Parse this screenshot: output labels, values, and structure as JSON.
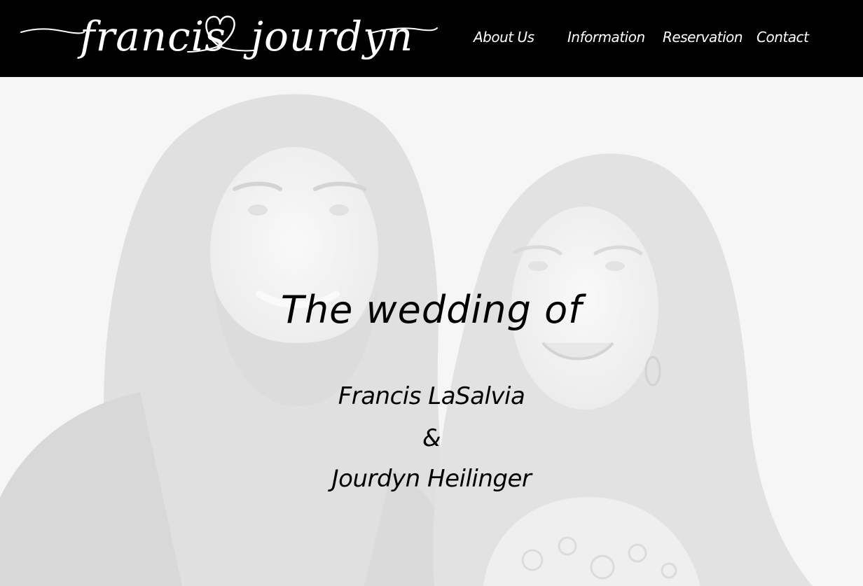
{
  "header": {
    "logo_text_left": "francis",
    "logo_text_right": "jourdyn",
    "nav": [
      {
        "label": "About Us"
      },
      {
        "label": "Information"
      },
      {
        "label": "Reservation"
      },
      {
        "label": "Contact"
      }
    ]
  },
  "hero": {
    "heading": "The wedding of",
    "name_1": "Francis LaSalvia",
    "ampersand": "&",
    "name_2": "Jourdyn Heilinger"
  },
  "colors": {
    "header_bg": "#000000",
    "header_text": "#ffffff",
    "hero_bg": "#f4f4f4",
    "hero_text": "#000000"
  },
  "icons": {
    "logo_heart": "heart-icon"
  }
}
